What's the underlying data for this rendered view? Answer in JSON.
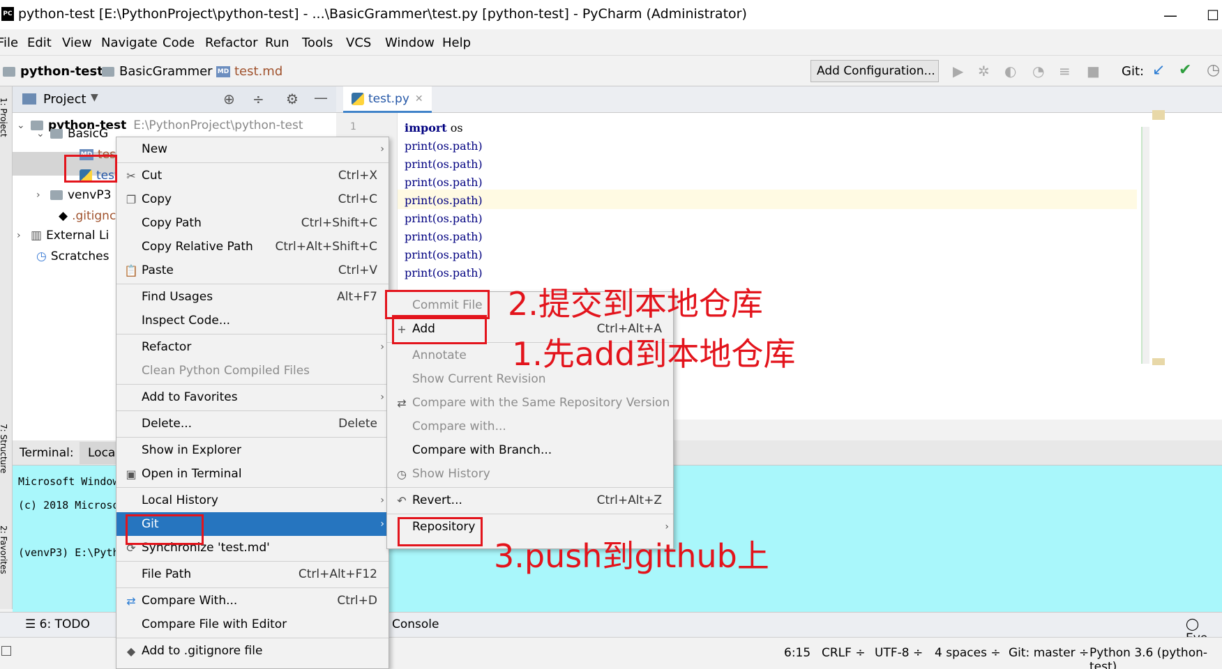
{
  "titlebar": {
    "logo": "PC",
    "title": "python-test [E:\\PythonProject\\python-test] - ...\\BasicGrammer\\test.py [python-test] - PyCharm (Administrator)",
    "minimize": "—",
    "maximize": "☐"
  },
  "menubar": [
    "File",
    "Edit",
    "View",
    "Navigate",
    "Code",
    "Refactor",
    "Run",
    "Tools",
    "VCS",
    "Window",
    "Help"
  ],
  "navbar": {
    "crumbs": [
      "python-test",
      "BasicGrammer",
      "test.md"
    ],
    "add_configuration": "Add Configuration...",
    "git_label": "Git:"
  },
  "left_stripe": {
    "project": "1: Project",
    "structure": "7: Structure",
    "favorites": "2: Favorites"
  },
  "project": {
    "title": "Project",
    "root_name": "python-test",
    "root_path": "E:\\PythonProject\\python-test",
    "items": [
      "BasicG",
      "test",
      "test",
      "venvP3",
      ".gitignc",
      "External Li",
      "Scratches"
    ]
  },
  "editor": {
    "tab": "test.py",
    "line_number": "1",
    "lines": [
      {
        "kw": "import",
        "rest": " os"
      },
      {
        "kw": "",
        "rest": "print(os.path)"
      },
      {
        "kw": "",
        "rest": "print(os.path)"
      },
      {
        "kw": "",
        "rest": "print(os.path)"
      },
      {
        "kw": "",
        "rest": "print(os.path)"
      },
      {
        "kw": "",
        "rest": "print(os.path)"
      },
      {
        "kw": "",
        "rest": "print(os.path)"
      },
      {
        "kw": "",
        "rest": "print(os.path)"
      },
      {
        "kw": "",
        "rest": "print(os.path)"
      }
    ]
  },
  "terminal": {
    "label": "Terminal:",
    "tab": "Loca",
    "lines": [
      "Microsoft Window",
      "(c) 2018 Microso",
      "",
      "(venvP3) E:\\Pyth"
    ]
  },
  "bottombar": {
    "todo": "6: TODO",
    "console": "Console",
    "event": "Eve"
  },
  "statusbar": {
    "position": "6:15",
    "line_sep": "CRLF ÷",
    "encoding": "UTF-8 ÷",
    "indent": "4 spaces ÷",
    "git": "Git: master ÷",
    "interpreter": "Python 3.6 (python-test)"
  },
  "context_menu": [
    {
      "label": "New",
      "shortcut": "",
      "icon": "",
      "submenu": true
    },
    {
      "label": "Cut",
      "shortcut": "Ctrl+X",
      "icon": "✂"
    },
    {
      "label": "Copy",
      "shortcut": "Ctrl+C",
      "icon": "❐"
    },
    {
      "label": "Copy Path",
      "shortcut": "Ctrl+Shift+C",
      "icon": ""
    },
    {
      "label": "Copy Relative Path",
      "shortcut": "Ctrl+Alt+Shift+C",
      "icon": ""
    },
    {
      "label": "Paste",
      "shortcut": "Ctrl+V",
      "icon": "📋"
    },
    {
      "label": "Find Usages",
      "shortcut": "Alt+F7",
      "icon": ""
    },
    {
      "label": "Inspect Code...",
      "shortcut": "",
      "icon": ""
    },
    {
      "label": "Refactor",
      "shortcut": "",
      "icon": "",
      "submenu": true
    },
    {
      "label": "Clean Python Compiled Files",
      "shortcut": "",
      "icon": "",
      "disabled": true
    },
    {
      "label": "Add to Favorites",
      "shortcut": "",
      "icon": "",
      "submenu": true
    },
    {
      "label": "Delete...",
      "shortcut": "Delete",
      "icon": ""
    },
    {
      "label": "Show in Explorer",
      "shortcut": "",
      "icon": ""
    },
    {
      "label": "Open in Terminal",
      "shortcut": "",
      "icon": "▣"
    },
    {
      "label": "Local History",
      "shortcut": "",
      "icon": "",
      "submenu": true
    },
    {
      "label": "Git",
      "shortcut": "",
      "icon": "",
      "submenu": true,
      "selected": true
    },
    {
      "label": "Synchronize 'test.md'",
      "shortcut": "",
      "icon": "⟳"
    },
    {
      "label": "File Path",
      "shortcut": "Ctrl+Alt+F12",
      "icon": ""
    },
    {
      "label": "Compare With...",
      "shortcut": "Ctrl+D",
      "icon": "⇄"
    },
    {
      "label": "Compare File with Editor",
      "shortcut": "",
      "icon": ""
    },
    {
      "label": "Add to .gitignore file",
      "shortcut": "",
      "icon": "◆"
    }
  ],
  "git_submenu": [
    {
      "label": "Commit File",
      "shortcut": "",
      "disabled": true
    },
    {
      "label": "Add",
      "shortcut": "Ctrl+Alt+A",
      "icon": "+"
    },
    {
      "label": "Annotate",
      "shortcut": "",
      "disabled": true
    },
    {
      "label": "Show Current Revision",
      "shortcut": "",
      "disabled": true
    },
    {
      "label": "Compare with the Same Repository Version",
      "shortcut": "",
      "disabled": true,
      "icon": "⇄"
    },
    {
      "label": "Compare with...",
      "shortcut": "",
      "disabled": true
    },
    {
      "label": "Compare with Branch...",
      "shortcut": ""
    },
    {
      "label": "Show History",
      "shortcut": "",
      "disabled": true,
      "icon": "◷"
    },
    {
      "label": "Revert...",
      "shortcut": "Ctrl+Alt+Z",
      "icon": "↶"
    },
    {
      "label": "Repository",
      "shortcut": "",
      "submenu": true
    }
  ],
  "annotations": {
    "step1": "1.先add到本地仓库",
    "step2": "2.提交到本地仓库",
    "step3": "3.push到github上"
  },
  "colors": {
    "selection": "#2675bf",
    "annotation": "#e3141c",
    "terminal_bg": "#a9f7fb"
  }
}
